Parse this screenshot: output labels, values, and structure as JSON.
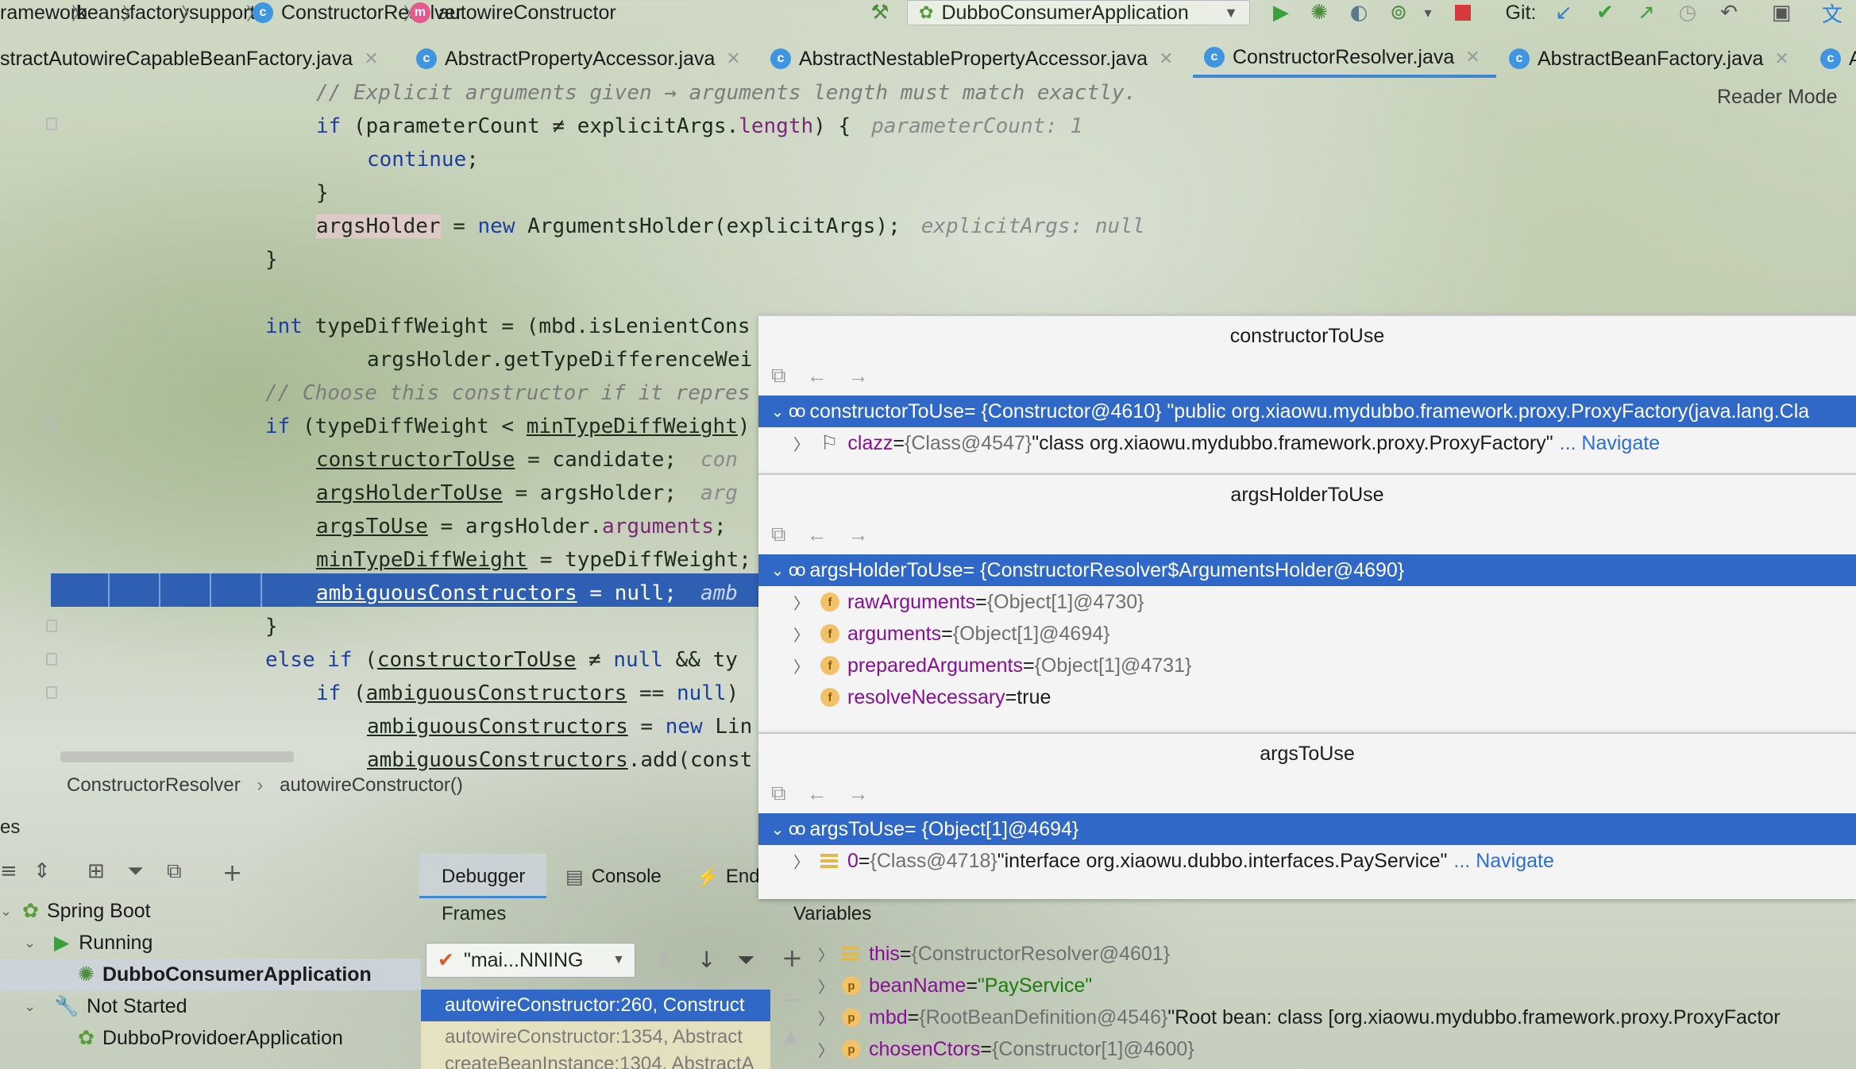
{
  "navbar": {
    "crumbs": [
      "ramework",
      "beans",
      "factory",
      "support",
      "ConstructorResolver",
      "autowireConstructor"
    ],
    "run_config": "DubboConsumerApplication",
    "git_label": "Git:"
  },
  "tabs": [
    {
      "label": "stractAutowireCapableBeanFactory.java"
    },
    {
      "label": "AbstractPropertyAccessor.java"
    },
    {
      "label": "AbstractNestablePropertyAccessor.java"
    },
    {
      "label": "ConstructorResolver.java",
      "active": true
    },
    {
      "label": "AbstractBeanFactory.java"
    },
    {
      "label": "A"
    }
  ],
  "reader_mode": "Reader Mode",
  "code": {
    "l1": "// Explicit arguments given → arguments length must match exactly.",
    "l2_a": "if",
    "l2_b": " (parameterCount ≠ explicitArgs.",
    "l2_c": "length",
    "l2_d": ") {",
    "l2_hint": "parameterCount: 1",
    "l3": "continue",
    "l3_end": ";",
    "l4": "}",
    "l5_a": "argsHolder",
    "l5_b": " = ",
    "l5_c": "new",
    "l5_d": " ArgumentsHolder(explicitArgs);",
    "l5_hint": "explicitArgs: null",
    "l6": "}",
    "l8_a": "int",
    "l8_b": " typeDiffWeight = (mbd.isLenientCons",
    "l9": "argsHolder.getTypeDifferenceWei",
    "l10": "// Choose this constructor if it repres",
    "l11_a": "if",
    "l11_b": " (typeDiffWeight < ",
    "l11_c": "minTypeDiffWeight",
    "l11_d": ")",
    "l12_a": "constructorToUse",
    "l12_b": " = candidate;",
    "l12_hint": "con",
    "l13_a": "argsHolderToUse",
    "l13_b": " = argsHolder;",
    "l13_hint": "arg",
    "l14_a": "argsToUse",
    "l14_b": " = argsHolder.",
    "l14_c": "arguments",
    "l14_d": ";",
    "l15_a": "minTypeDiffWeight",
    "l15_b": " = typeDiffWeight;",
    "l16_a": "ambiguousConstructors",
    "l16_b": " = null;",
    "l16_hint": "amb",
    "l17": "}",
    "l18_a": "else if",
    "l18_b": " (",
    "l18_c": "constructorToUse",
    "l18_d": " ≠ ",
    "l18_e": "null",
    "l18_f": " && ty",
    "l19_a": "if",
    "l19_b": " (",
    "l19_c": "ambiguousConstructors",
    "l19_d": " == ",
    "l19_e": "null",
    "l19_f": ")",
    "l20_a": "ambiguousConstructors",
    "l20_b": " = ",
    "l20_c": "new",
    "l20_d": " Lin",
    "l21_a": "ambiguousConstructors",
    "l21_b": ".add(const"
  },
  "editor_breadcrumbs": [
    "ConstructorResolver",
    "autowireConstructor()"
  ],
  "services": {
    "header": "es",
    "items": [
      {
        "label": "Spring Boot"
      },
      {
        "label": "Running"
      },
      {
        "label": "DubboConsumerApplication"
      },
      {
        "label": "Not Started"
      },
      {
        "label": "DubboProvidoerApplication"
      }
    ]
  },
  "debugger": {
    "tabs": [
      "Debugger",
      "Console",
      "End"
    ],
    "frames_label": "Frames",
    "variables_label": "Variables",
    "thread": "\"mai...NNING",
    "frames": [
      "autowireConstructor:260, Construct",
      "autowireConstructor:1354, Abstract",
      "createBeanInstance:1304, AbstractA"
    ]
  },
  "popups": {
    "p1": {
      "title": "constructorToUse",
      "row1_name": "constructorToUse",
      "row1_value": " = {Constructor@4610} \"public org.xiaowu.mydubbo.framework.proxy.ProxyFactory(java.lang.Cla",
      "row2_name": "clazz",
      "row2_type": "{Class@4547}",
      "row2_value": " \"class org.xiaowu.mydubbo.framework.proxy.ProxyFactory\"",
      "row2_link": "... Navigate"
    },
    "p2": {
      "title": "argsHolderToUse",
      "row1_name": "argsHolderToUse",
      "row1_value": " = {ConstructorResolver$ArgumentsHolder@4690}",
      "fields": [
        {
          "name": "rawArguments",
          "value": "{Object[1]@4730}"
        },
        {
          "name": "arguments",
          "value": "{Object[1]@4694}"
        },
        {
          "name": "preparedArguments",
          "value": "{Object[1]@4731}"
        },
        {
          "name": "resolveNecessary",
          "value": "true"
        }
      ]
    },
    "p3": {
      "title": "argsToUse",
      "row1_name": "argsToUse",
      "row1_value": " = {Object[1]@4694}",
      "row2_name": "0",
      "row2_type": "{Class@4718}",
      "row2_value": " \"interface org.xiaowu.dubbo.interfaces.PayService\"",
      "row2_link": "... Navigate"
    }
  },
  "variables": [
    {
      "name": "this",
      "value": "{ConstructorResolver@4601}"
    },
    {
      "name": "beanName",
      "value": "\"PayService\""
    },
    {
      "name": "mbd",
      "value": "{RootBeanDefinition@4546}",
      "extra": " \"Root bean: class [org.xiaowu.mydubbo.framework.proxy.ProxyFactor"
    },
    {
      "name": "chosenCtors",
      "value": "{Constructor[1]@4600}"
    }
  ]
}
